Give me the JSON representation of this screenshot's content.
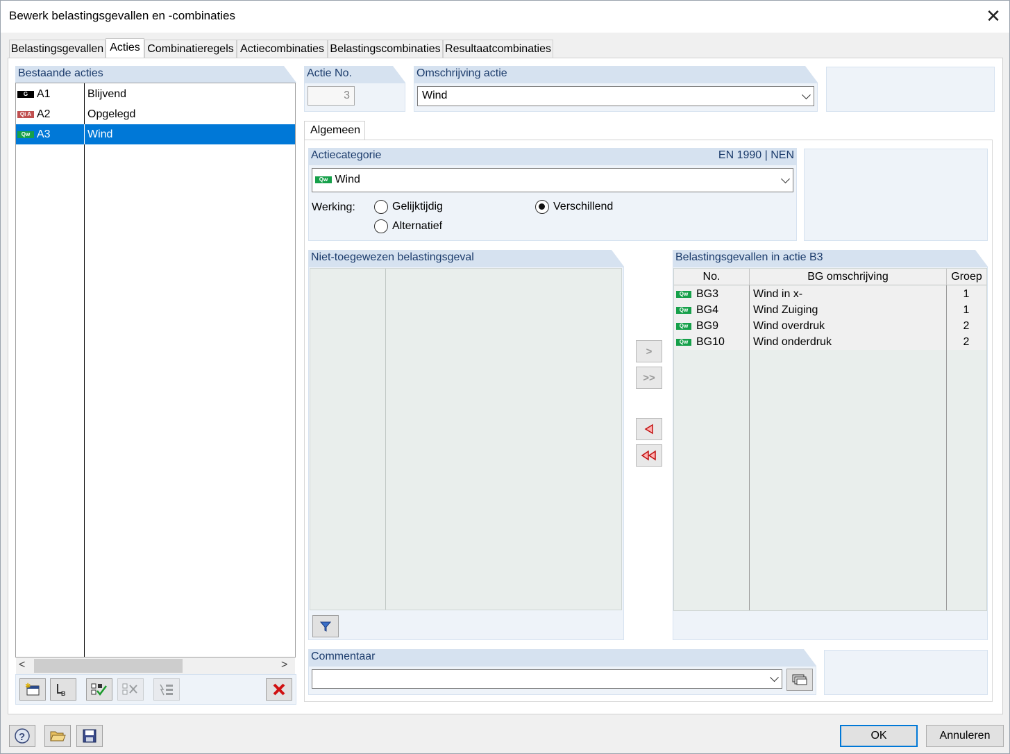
{
  "window": {
    "title": "Bewerk belastingsgevallen en -combinaties"
  },
  "tabs": [
    {
      "label": "Belastingsgevallen"
    },
    {
      "label": "Acties"
    },
    {
      "label": "Combinatieregels"
    },
    {
      "label": "Actiecombinaties"
    },
    {
      "label": "Belastingscombinaties"
    },
    {
      "label": "Resultaatcombinaties"
    }
  ],
  "actions_list": {
    "header": "Bestaande acties",
    "items": [
      {
        "badge": "G",
        "id": "A1",
        "name": "Blijvend"
      },
      {
        "badge": "Qi A",
        "id": "A2",
        "name": "Opgelegd"
      },
      {
        "badge": "Qw",
        "id": "A3",
        "name": "Wind"
      }
    ],
    "selected": "A3"
  },
  "action_no": {
    "label": "Actie No.",
    "value": "3"
  },
  "action_desc": {
    "label": "Omschrijving actie",
    "value": "Wind"
  },
  "subtab": {
    "label": "Algemeen"
  },
  "category": {
    "header": "Actiecategorie",
    "norm": "EN 1990 | NEN",
    "badge": "Qw",
    "value": "Wind",
    "werking_label": "Werking:",
    "options": [
      {
        "label": "Gelijktijdig",
        "checked": false
      },
      {
        "label": "Verschillend",
        "checked": true
      },
      {
        "label": "Alternatief",
        "checked": false
      }
    ]
  },
  "unassigned": {
    "header": "Niet-toegewezen belastingsgeval"
  },
  "assigned": {
    "header": "Belastingsgevallen in actie B3",
    "columns": [
      "No.",
      "BG omschrijving",
      "Groep"
    ],
    "rows": [
      {
        "badge": "Qw",
        "no": "BG3",
        "desc": "Wind in x-",
        "group": "1"
      },
      {
        "badge": "Qw",
        "no": "BG4",
        "desc": "Wind Zuiging",
        "group": "1"
      },
      {
        "badge": "Qw",
        "no": "BG9",
        "desc": "Wind overdruk",
        "group": "2"
      },
      {
        "badge": "Qw",
        "no": "BG10",
        "desc": "Wind onderdruk",
        "group": "2"
      }
    ]
  },
  "comment": {
    "header": "Commentaar",
    "value": ""
  },
  "buttons": {
    "ok": "OK",
    "cancel": "Annuleren"
  }
}
